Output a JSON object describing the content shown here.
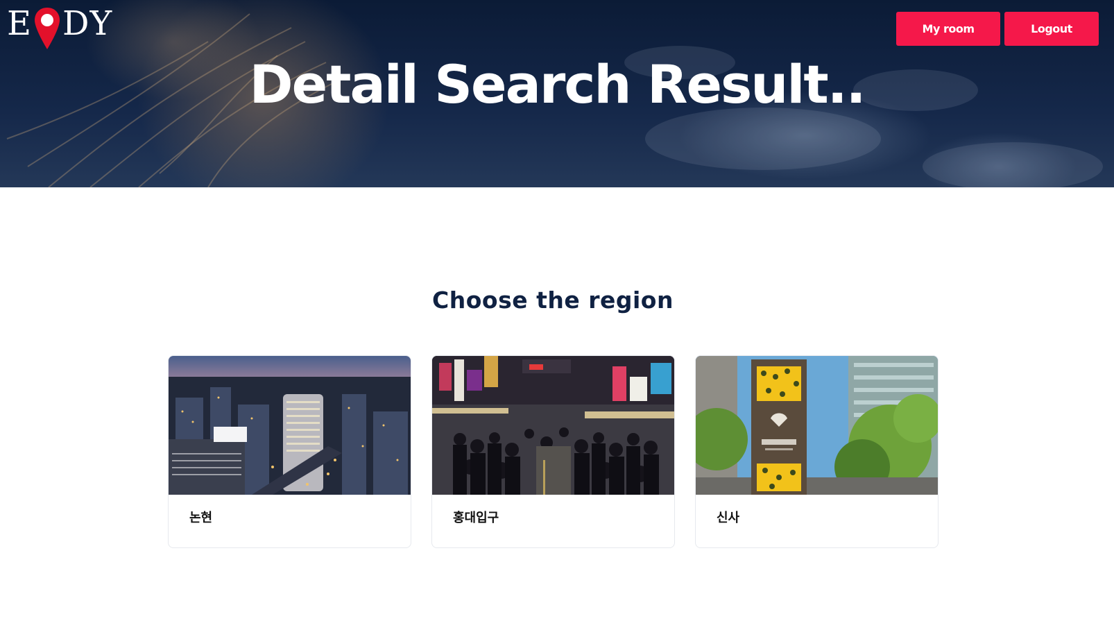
{
  "header": {
    "logo": {
      "text_left": "E",
      "text_right": "DY",
      "pin_icon": "map-pin-icon"
    },
    "nav": {
      "my_room_label": "My room",
      "logout_label": "Logout"
    },
    "title": "Detail Search Result.."
  },
  "main": {
    "section_title": "Choose the region",
    "regions": [
      {
        "label": "논현",
        "image": "city-night-aerial"
      },
      {
        "label": "홍대입구",
        "image": "crowded-street-night"
      },
      {
        "label": "신사",
        "image": "garosugil-sign-trees"
      }
    ]
  },
  "colors": {
    "accent": "#f5184a",
    "hero_bg": "#0b1b36",
    "title_text": "#0f2142"
  }
}
